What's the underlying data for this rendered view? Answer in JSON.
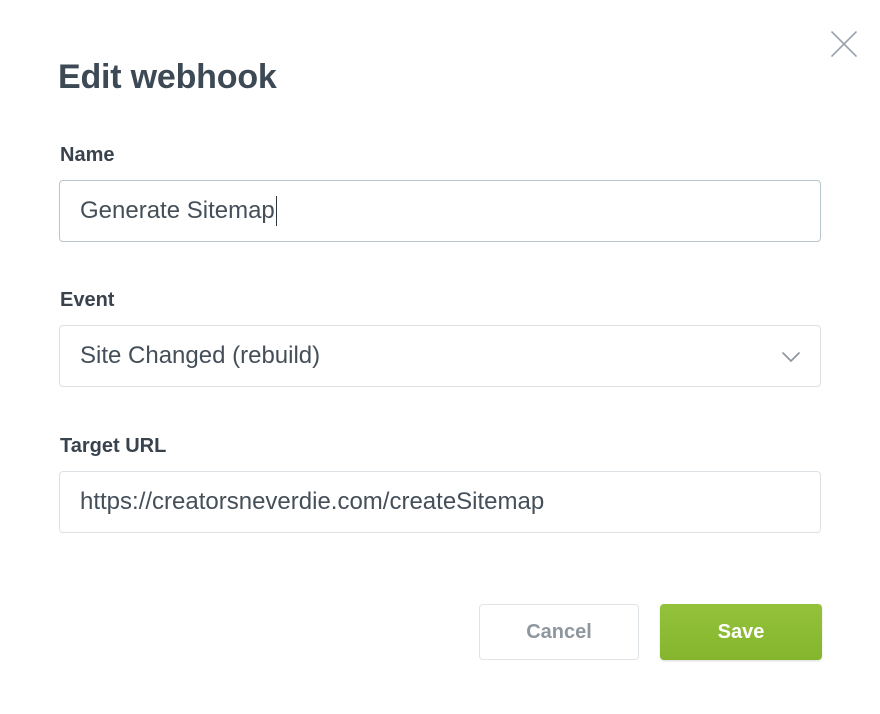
{
  "dialog": {
    "title": "Edit webhook",
    "close_icon": "close-icon"
  },
  "fields": {
    "name": {
      "label": "Name",
      "value": "Generate Sitemap"
    },
    "event": {
      "label": "Event",
      "value": "Site Changed (rebuild)",
      "icon": "chevron-down-icon"
    },
    "target_url": {
      "label": "Target URL",
      "value": "https://creatorsneverdie.com/createSitemap"
    }
  },
  "actions": {
    "cancel_label": "Cancel",
    "save_label": "Save"
  },
  "colors": {
    "accent": "#8bbd35",
    "title": "#3d4a56",
    "input_border": "#dbe1e5"
  }
}
